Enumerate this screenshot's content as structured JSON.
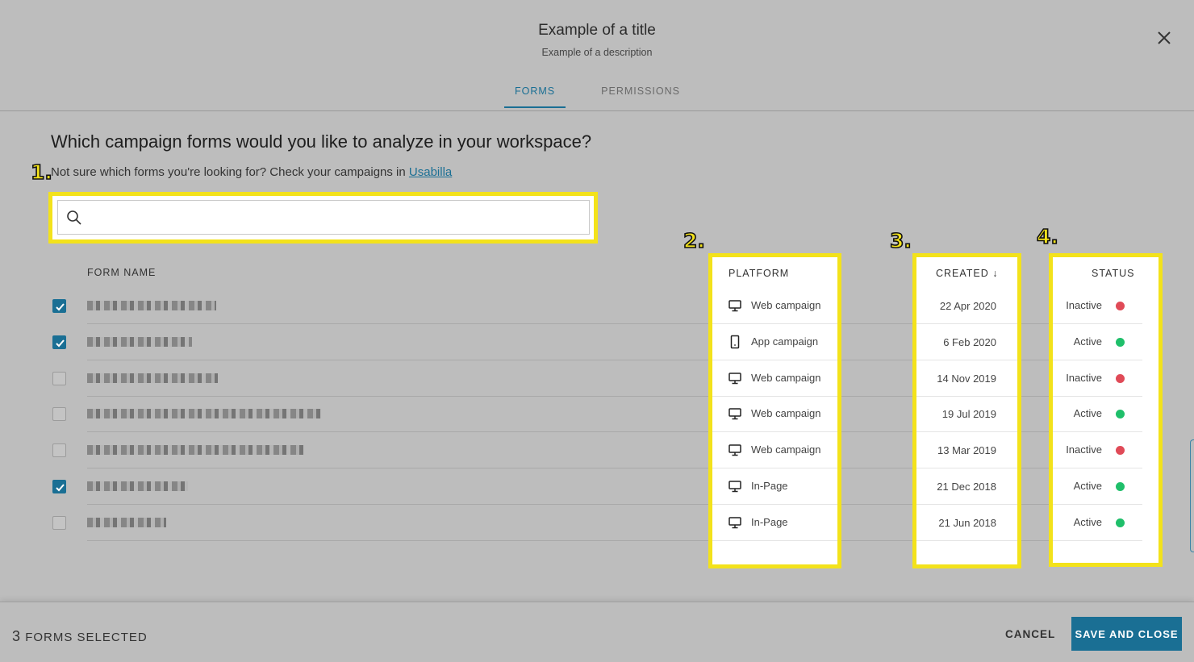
{
  "header": {
    "title": "Example of a title",
    "description": "Example of a description",
    "close_icon": "close-icon"
  },
  "tabs": [
    {
      "label": "FORMS",
      "active": true
    },
    {
      "label": "PERMISSIONS",
      "active": false
    }
  ],
  "main": {
    "question": "Which campaign forms would you like to analyze in your workspace?",
    "hint_text": "Not sure which forms you're looking for? Check your campaigns in ",
    "hint_link": "Usabilla"
  },
  "search": {
    "value": "",
    "placeholder": "",
    "icon": "search-icon"
  },
  "columns": {
    "form_name": "FORM NAME",
    "platform": "PLATFORM",
    "created": "CREATED ↓",
    "status": "STATUS"
  },
  "markers": [
    "1.",
    "2.",
    "3.",
    "4."
  ],
  "rows": [
    {
      "checked": true,
      "platform": "Web campaign",
      "platform_icon": "desktop-icon",
      "created": "22 Apr 2020",
      "status": "Inactive"
    },
    {
      "checked": true,
      "platform": "App campaign",
      "platform_icon": "mobile-icon",
      "created": "6 Feb 2020",
      "status": "Active"
    },
    {
      "checked": false,
      "platform": "Web campaign",
      "platform_icon": "desktop-icon",
      "created": "14 Nov 2019",
      "status": "Inactive"
    },
    {
      "checked": false,
      "platform": "Web campaign",
      "platform_icon": "desktop-icon",
      "created": "19 Jul 2019",
      "status": "Active"
    },
    {
      "checked": false,
      "platform": "Web campaign",
      "platform_icon": "desktop-icon",
      "created": "13 Mar 2019",
      "status": "Inactive"
    },
    {
      "checked": true,
      "platform": "In-Page",
      "platform_icon": "desktop-icon",
      "created": "21 Dec 2018",
      "status": "Active"
    },
    {
      "checked": false,
      "platform": "In-Page",
      "platform_icon": "desktop-icon",
      "created": "21 Jun 2018",
      "status": "Active"
    }
  ],
  "colors": {
    "accent": "#1a6f94",
    "highlight": "#f3e21b",
    "status_active": "#1fbf6a",
    "status_inactive": "#e04a57"
  },
  "footer": {
    "count": "3",
    "count_label": "FORMS SELECTED",
    "cancel_label": "CANCEL",
    "save_label": "SAVE AND CLOSE"
  }
}
